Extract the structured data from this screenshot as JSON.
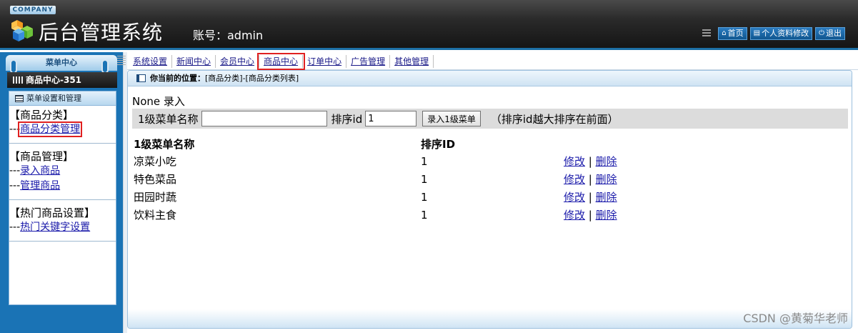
{
  "header": {
    "company": "COMPANY",
    "title": "后台管理系统",
    "account_label": "账号：admin",
    "links": [
      {
        "icon": "home-icon",
        "glyph": "⌂",
        "label": "首页"
      },
      {
        "icon": "document-icon",
        "glyph": "▤",
        "label": "个人资料修改"
      },
      {
        "icon": "power-icon",
        "glyph": "⏻",
        "label": "退出"
      }
    ]
  },
  "sidebar": {
    "menu_center": "菜单中心",
    "module": "商品中心-351",
    "panel_title": "菜单设置和管理",
    "groups": [
      {
        "title": "【商品分类】",
        "items": [
          {
            "prefix": "---",
            "label": "商品分类管理"
          }
        ]
      },
      {
        "title": "【商品管理】",
        "items": [
          {
            "prefix": "---",
            "label": "录入商品"
          },
          {
            "prefix": "---",
            "label": "管理商品"
          }
        ]
      },
      {
        "title": "【热门商品设置】",
        "items": [
          {
            "prefix": "---",
            "label": "热门关键字设置"
          }
        ]
      }
    ]
  },
  "topnav": {
    "items": [
      "系统设置",
      "新闻中心",
      "会员中心",
      "商品中心",
      "订单中心",
      "广告管理",
      "其他管理"
    ],
    "active": "商品中心"
  },
  "main": {
    "location_label": "你当前的位置：",
    "location_value": "[商品分类]-[商品分类列表]",
    "page_heading": "None 录入",
    "form": {
      "name_label": "1级菜单名称",
      "name_value": "",
      "sort_label": "排序id",
      "sort_value": "1",
      "submit_label": "录入1级菜单",
      "hint": "（排序id越大排序在前面）"
    },
    "table": {
      "headers": [
        "1级菜单名称",
        "排序ID",
        ""
      ],
      "rows": [
        {
          "name": "凉菜小吃",
          "sort": "1",
          "edit": "修改",
          "sep": "|",
          "del": "删除"
        },
        {
          "name": "特色菜品",
          "sort": "1",
          "edit": "修改",
          "sep": "|",
          "del": "删除"
        },
        {
          "name": "田园时蔬",
          "sort": "1",
          "edit": "修改",
          "sep": "|",
          "del": "删除"
        },
        {
          "name": "饮料主食",
          "sort": "1",
          "edit": "修改",
          "sep": "|",
          "del": "删除"
        }
      ]
    }
  },
  "watermark": "CSDN @黄菊华老师",
  "colors": {
    "accent": "#1a73b5",
    "highlight": "#e02020",
    "link": "#1a1aaa"
  }
}
